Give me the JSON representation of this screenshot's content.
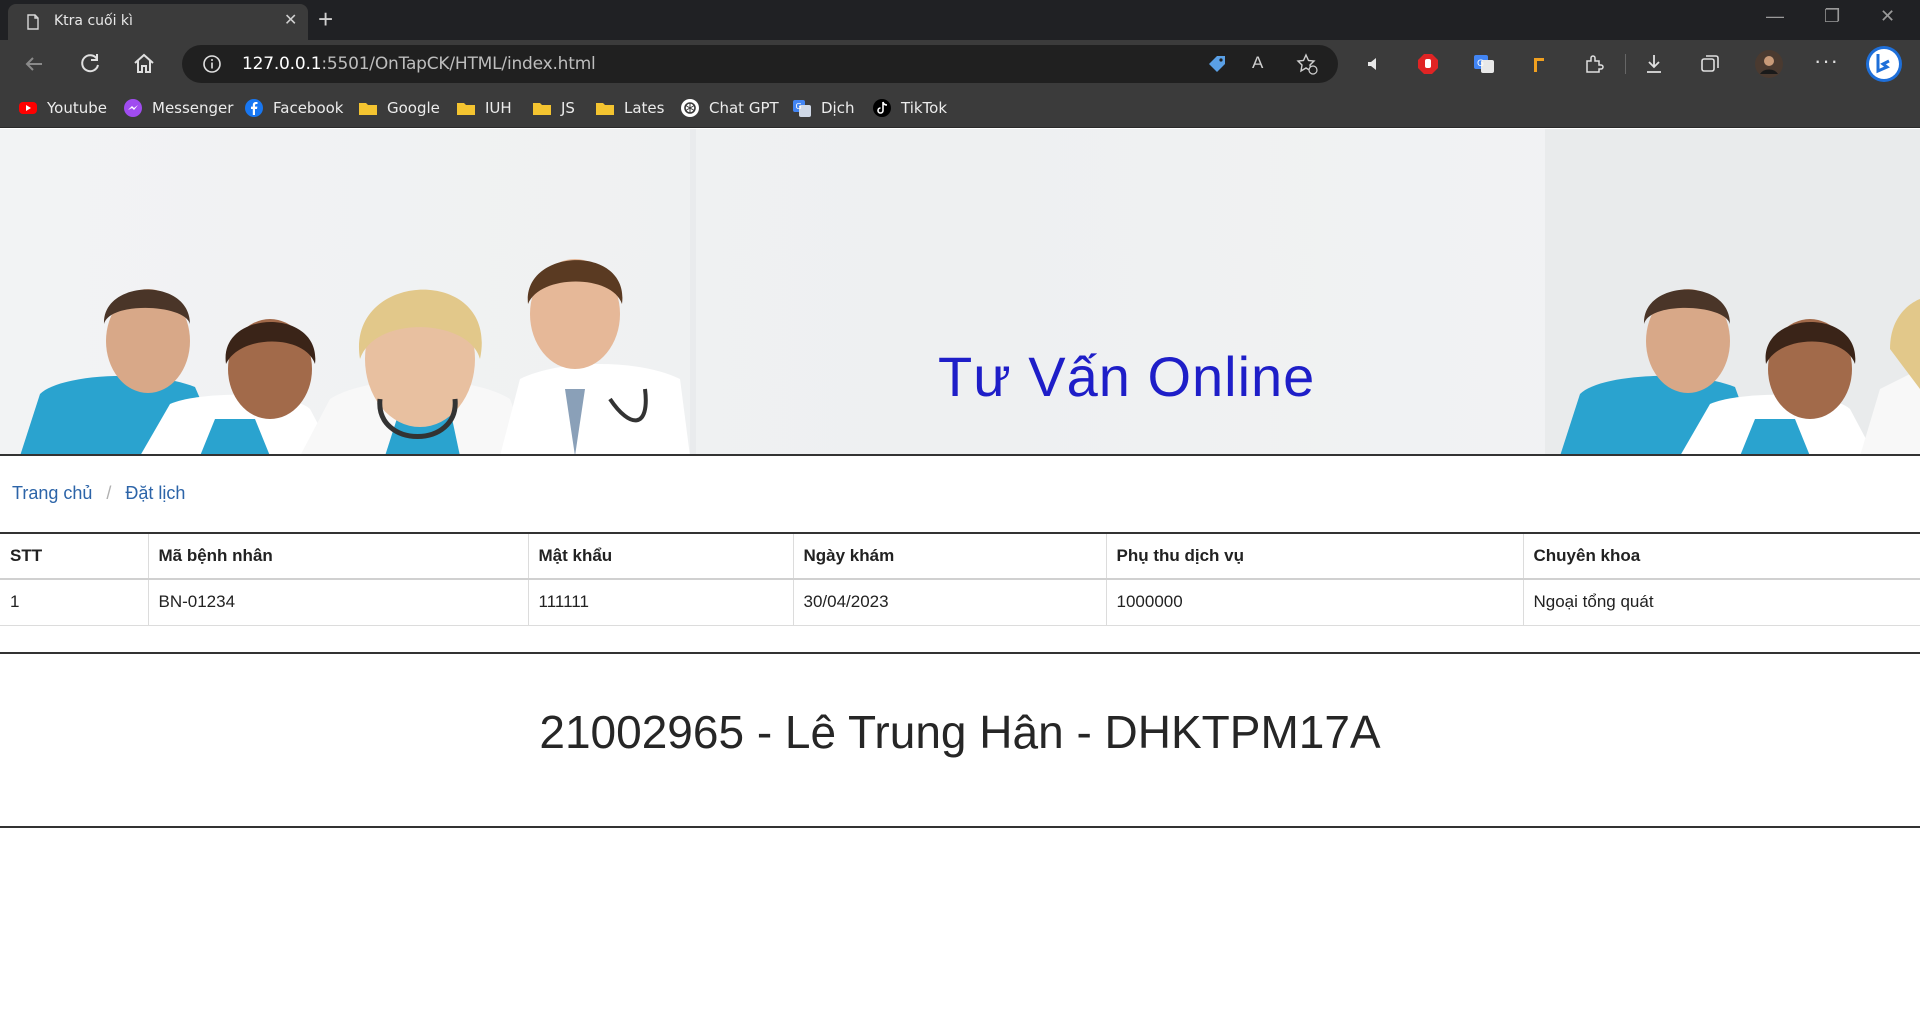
{
  "browser": {
    "tab": {
      "title": "Ktra cuối kì"
    },
    "address": {
      "host": "127.0.0.1",
      "rest": ":5501/OnTapCK/HTML/index.html"
    },
    "bookmarks": [
      {
        "label": "Youtube",
        "icon": "youtube-icon"
      },
      {
        "label": "Messenger",
        "icon": "messenger-icon"
      },
      {
        "label": "Facebook",
        "icon": "facebook-icon"
      },
      {
        "label": "Google",
        "icon": "folder-icon"
      },
      {
        "label": "IUH",
        "icon": "folder-icon"
      },
      {
        "label": "JS",
        "icon": "folder-icon"
      },
      {
        "label": "Lates",
        "icon": "folder-icon"
      },
      {
        "label": "Chat GPT",
        "icon": "chatgpt-icon"
      },
      {
        "label": "Dịch",
        "icon": "translate-icon"
      },
      {
        "label": "TikTok",
        "icon": "tiktok-icon"
      }
    ]
  },
  "banner": {
    "title": "Tư Vấn Online"
  },
  "breadcrumb": {
    "home": "Trang chủ",
    "current": "Đặt lịch"
  },
  "table": {
    "headers": [
      "STT",
      "Mã bệnh nhân",
      "Mật khẩu",
      "Ngày khám",
      "Phụ thu dịch vụ",
      "Chuyên khoa"
    ],
    "rows": [
      [
        "1",
        "BN-01234",
        "111111",
        "30/04/2023",
        "1000000",
        "Ngoại tổng quát"
      ]
    ]
  },
  "footer": {
    "text": "21002965 - Lê Trung Hân - DHKTPM17A"
  },
  "colors": {
    "banner_title": "#1e1ec8",
    "link": "#2c64a8",
    "chrome_dark": "#202124",
    "chrome": "#3b3b3b"
  }
}
